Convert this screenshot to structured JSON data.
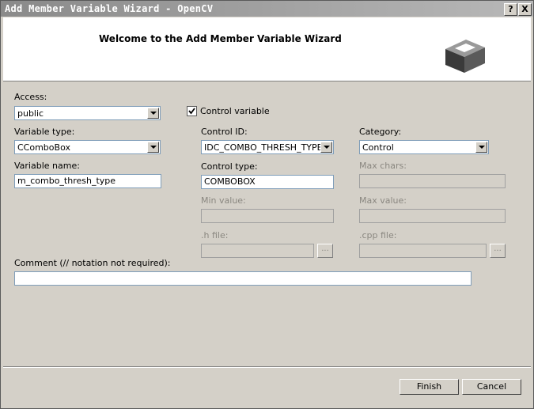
{
  "window": {
    "title": "Add Member Variable Wizard - OpenCV",
    "help_button": "?",
    "close_button": "X"
  },
  "header": {
    "title": "Welcome to the Add Member Variable Wizard",
    "icon": "wizard-box-icon"
  },
  "form": {
    "access": {
      "label": "Access:",
      "value": "public"
    },
    "control_variable": {
      "label": "Control variable",
      "checked": true
    },
    "variable_type": {
      "label": "Variable type:",
      "value": "CComboBox"
    },
    "control_id": {
      "label": "Control ID:",
      "value": "IDC_COMBO_THRESH_TYPE"
    },
    "category": {
      "label": "Category:",
      "value": "Control"
    },
    "variable_name": {
      "label": "Variable name:",
      "value": "m_combo_thresh_type"
    },
    "control_type": {
      "label": "Control type:",
      "value": "COMBOBOX"
    },
    "max_chars": {
      "label": "Max chars:",
      "value": ""
    },
    "min_value": {
      "label": "Min value:",
      "value": ""
    },
    "max_value": {
      "label": "Max value:",
      "value": ""
    },
    "h_file": {
      "label": ".h file:",
      "value": "",
      "browse": "..."
    },
    "cpp_file": {
      "label": ".cpp file:",
      "value": "",
      "browse": "..."
    },
    "comment": {
      "label": "Comment (// notation not required):",
      "value": ""
    }
  },
  "buttons": {
    "finish": "Finish",
    "cancel": "Cancel"
  }
}
